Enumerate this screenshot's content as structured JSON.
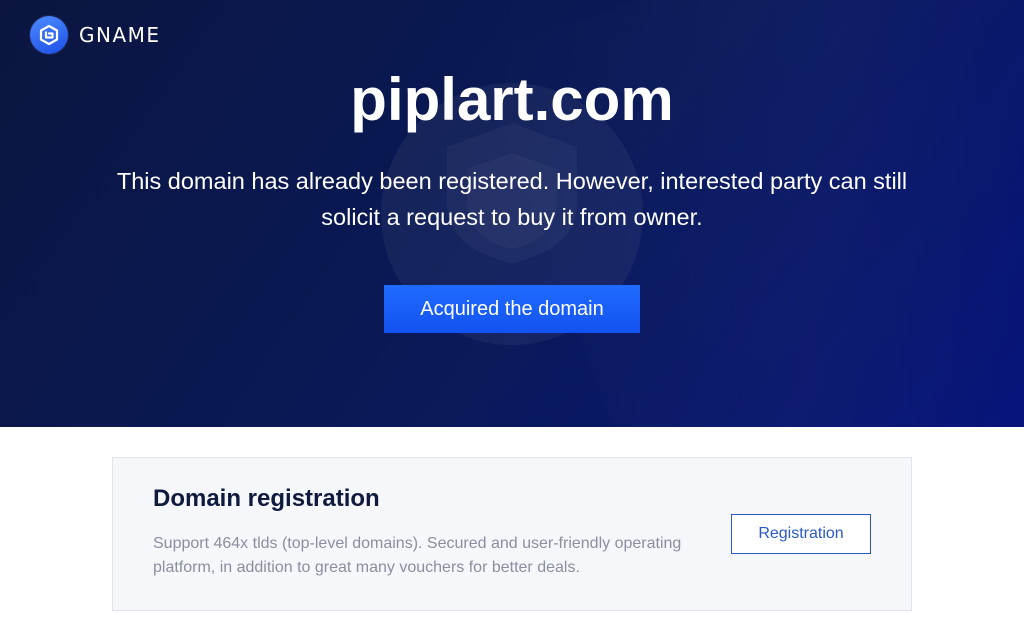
{
  "brand": {
    "name": "GNAME",
    "logo_icon": "gname-g-logo-icon"
  },
  "hero": {
    "domain": "piplart.com",
    "description": "This domain has already been registered. However, interested party can still solicit a request to buy it from owner.",
    "cta_label": "Acquired the domain",
    "watermark_icon": "shield-icon"
  },
  "registration_card": {
    "title": "Domain registration",
    "description": "Support 464x tlds (top-level domains). Secured and user-friendly operating platform, in addition to great many vouchers for better deals.",
    "button_label": "Registration"
  },
  "colors": {
    "hero_bg": "#0a1a5a",
    "accent": "#1f6bff",
    "card_bg": "#f6f7fb",
    "link_blue": "#2b59c3"
  }
}
